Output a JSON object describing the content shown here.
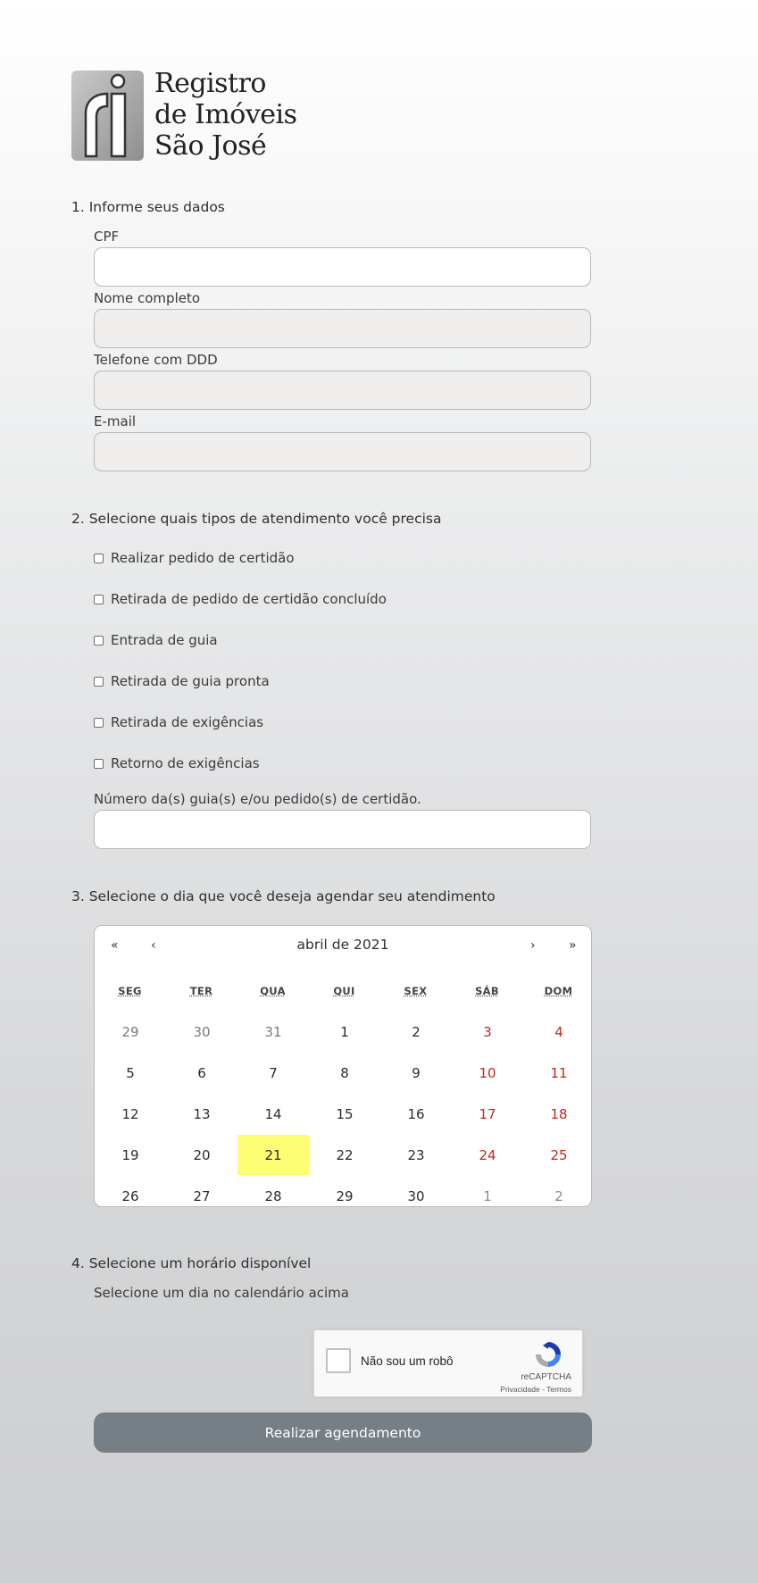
{
  "logo": {
    "line1": "Registro",
    "line2": "de Imóveis",
    "line3": "São José"
  },
  "section1": {
    "title": "1. Informe seus dados",
    "fields": [
      {
        "label": "CPF",
        "value": ""
      },
      {
        "label": "Nome completo",
        "value": ""
      },
      {
        "label": "Telefone com DDD",
        "value": ""
      },
      {
        "label": "E-mail",
        "value": ""
      }
    ]
  },
  "section2": {
    "title": "2. Selecione quais tipos de atendimento você precisa",
    "options": [
      "Realizar pedido de certidão",
      "Retirada de pedido de certidão concluído",
      "Entrada de guia",
      "Retirada de guia pronta",
      "Retirada de exigências",
      "Retorno de exigências"
    ],
    "numbers_label": "Número da(s) guia(s) e/ou pedido(s) de certidão.",
    "numbers_value": ""
  },
  "section3": {
    "title": "3. Selecione o dia que você deseja agendar seu atendimento",
    "calendar": {
      "nav_first": "«",
      "nav_prev": "‹",
      "month_label": "abril de 2021",
      "nav_next": "›",
      "nav_last": "»",
      "weekdays": [
        "SEG",
        "TER",
        "QUA",
        "QUI",
        "SEX",
        "SÁB",
        "DOM"
      ],
      "weeks": [
        [
          "29",
          "30",
          "31",
          "1",
          "2",
          "3",
          "4"
        ],
        [
          "5",
          "6",
          "7",
          "8",
          "9",
          "10",
          "11"
        ],
        [
          "12",
          "13",
          "14",
          "15",
          "16",
          "17",
          "18"
        ],
        [
          "19",
          "20",
          "21",
          "22",
          "23",
          "24",
          "25"
        ],
        [
          "26",
          "27",
          "28",
          "29",
          "30",
          "1",
          "2"
        ]
      ],
      "selected_day": "21",
      "highlight_color": "#fefe74",
      "weekend_color": "#c0281e"
    }
  },
  "section4": {
    "title": "4. Selecione um horário disponível",
    "hint": "Selecione um dia no calendário acima"
  },
  "recaptcha": {
    "label": "Não sou um robô",
    "brand": "reCAPTCHA",
    "privacy": "Privacidade",
    "separator": " - ",
    "terms": "Termos"
  },
  "submit": {
    "label": "Realizar agendamento",
    "color": "#777f86"
  }
}
